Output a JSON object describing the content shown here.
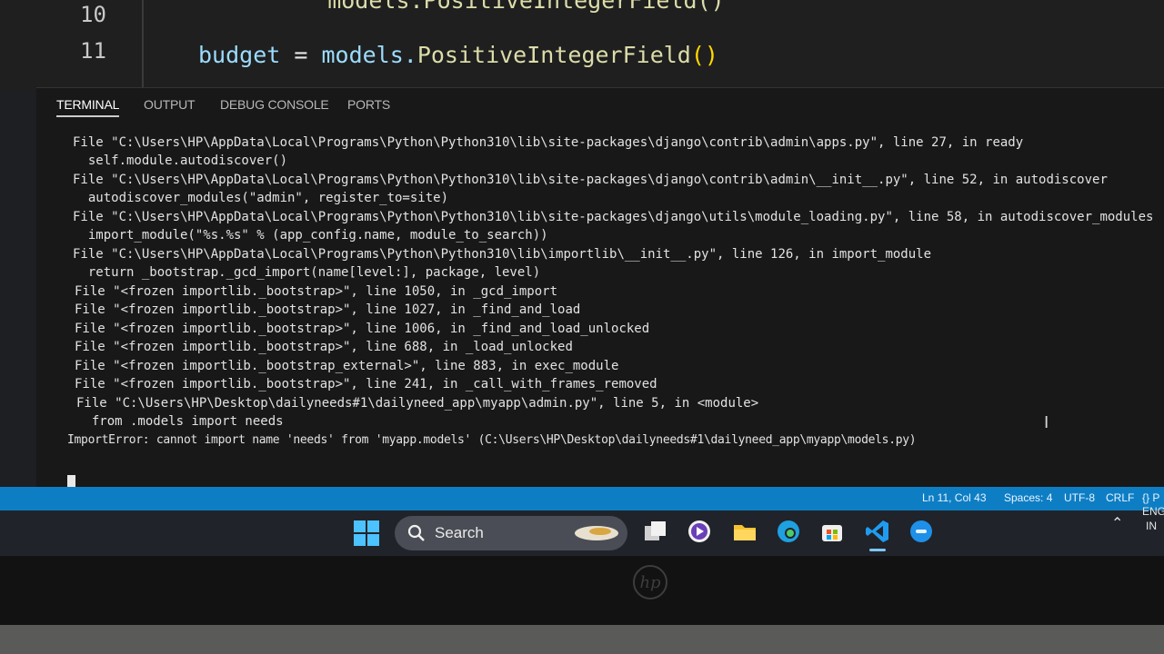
{
  "editor": {
    "lines": [
      {
        "num": "10",
        "code": "    models.PositiveIntegerField()"
      },
      {
        "num": "11",
        "code_var": "budget",
        "code_eq": " = ",
        "code_mod": "models.",
        "code_fn": "PositiveIntegerField",
        "code_paren": "()"
      }
    ]
  },
  "panel": {
    "tabs": [
      "TERMINAL",
      "OUTPUT",
      "DEBUG CONSOLE",
      "PORTS"
    ],
    "active_tab": "TERMINAL"
  },
  "terminal": {
    "lines": [
      "File \"C:\\Users\\HP\\AppData\\Local\\Programs\\Python\\Python310\\lib\\site-packages\\django\\contrib\\admin\\apps.py\", line 27, in ready",
      "  self.module.autodiscover()",
      "File \"C:\\Users\\HP\\AppData\\Local\\Programs\\Python\\Python310\\lib\\site-packages\\django\\contrib\\admin\\__init__.py\", line 52, in autodiscover",
      "  autodiscover_modules(\"admin\", register_to=site)",
      "File \"C:\\Users\\HP\\AppData\\Local\\Programs\\Python\\Python310\\lib\\site-packages\\django\\utils\\module_loading.py\", line 58, in autodiscover_modules",
      "  import_module(\"%s.%s\" % (app_config.name, module_to_search))",
      "File \"C:\\Users\\HP\\AppData\\Local\\Programs\\Python\\Python310\\lib\\importlib\\__init__.py\", line 126, in import_module",
      "  return _bootstrap._gcd_import(name[level:], package, level)",
      "File \"<frozen importlib._bootstrap>\", line 1050, in _gcd_import",
      "File \"<frozen importlib._bootstrap>\", line 1027, in _find_and_load",
      "File \"<frozen importlib._bootstrap>\", line 1006, in _find_and_load_unlocked",
      "File \"<frozen importlib._bootstrap>\", line 688, in _load_unlocked",
      "File \"<frozen importlib._bootstrap_external>\", line 883, in exec_module",
      "File \"<frozen importlib._bootstrap>\", line 241, in _call_with_frames_removed",
      "File \"C:\\Users\\HP\\Desktop\\dailyneeds#1\\dailyneed_app\\myapp\\admin.py\", line 5, in <module>",
      "  from .models import needs",
      "ImportError: cannot import name 'needs' from 'myapp.models' (C:\\Users\\HP\\Desktop\\dailyneeds#1\\dailyneed_app\\myapp\\models.py)"
    ]
  },
  "statusbar": {
    "position": "Ln 11, Col 43",
    "spaces": "Spaces: 4",
    "encoding": "UTF-8",
    "eol": "CRLF",
    "language": "{} P"
  },
  "taskbar": {
    "search_label": "Search",
    "tray_lang": "ENG",
    "tray_region": "IN"
  },
  "colors": {
    "statusbar": "#0e7ec4",
    "taskbar": "#20232a",
    "terminal_bg": "#181818"
  },
  "device": {
    "logo": "hp"
  }
}
